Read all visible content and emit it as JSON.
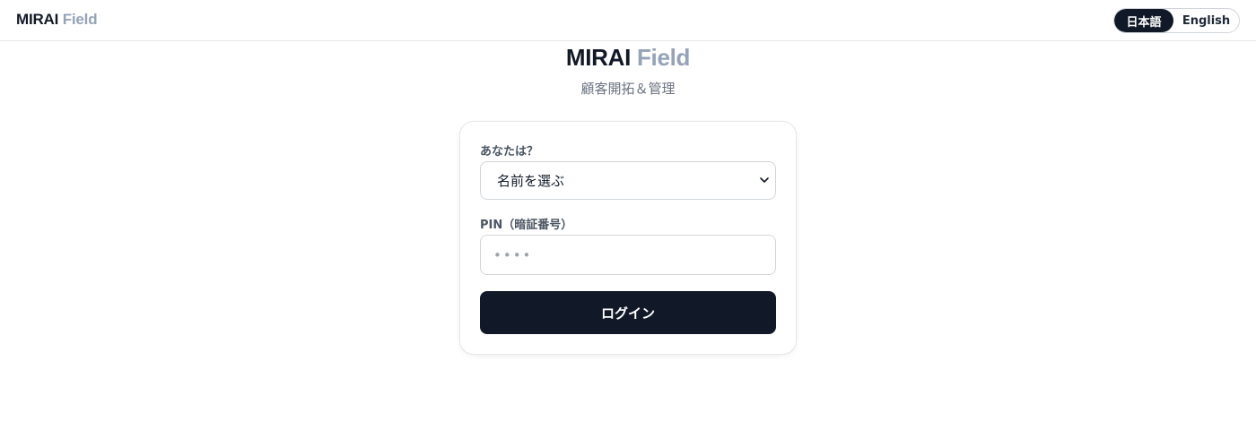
{
  "header": {
    "brand_primary": "MIRAI",
    "brand_secondary": "Field",
    "languages": [
      {
        "label": "日本語",
        "active": true
      },
      {
        "label": "English",
        "active": false
      }
    ]
  },
  "hero": {
    "title_primary": "MIRAI",
    "title_secondary": "Field",
    "subtitle": "顧客開拓＆管理"
  },
  "login_form": {
    "user_label": "あなたは？",
    "user_select_value": "名前を選ぶ",
    "pin_label": "PIN（暗証番号）",
    "pin_placeholder": "••••",
    "submit_label": "ログイン"
  },
  "colors": {
    "brand_dark": "#111827",
    "brand_muted": "#94a3b8",
    "border": "#d1d5db"
  },
  "icons": {
    "select_chevron": "chevron-down-icon"
  }
}
